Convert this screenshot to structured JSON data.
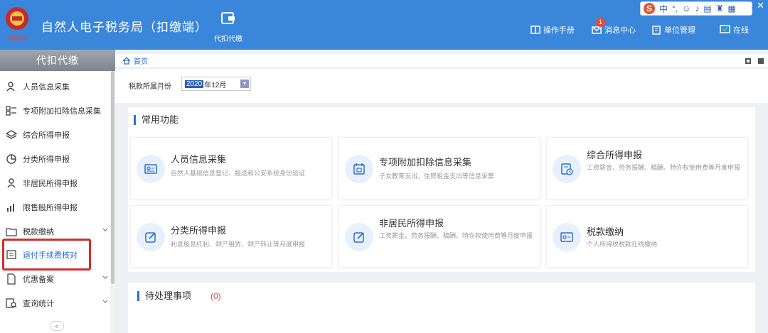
{
  "header": {
    "app_title": "自然人电子税务局（扣缴端）",
    "nav_tab": "代扣代缴",
    "manual": "操作手册",
    "messages": "消息中心",
    "message_count": "1",
    "unit_mgmt": "单位管理",
    "status": "在线",
    "ime_lang": "中"
  },
  "sidebar": {
    "title": "代扣代缴",
    "items": [
      {
        "label": "人员信息采集"
      },
      {
        "label": "专项附加扣除信息采集"
      },
      {
        "label": "综合所得申报"
      },
      {
        "label": "分类所得申报"
      },
      {
        "label": "非居民所得申报"
      },
      {
        "label": "限售股所得申报"
      },
      {
        "label": "税款缴纳"
      },
      {
        "label": "退付手续费核对"
      },
      {
        "label": "优惠备案"
      },
      {
        "label": "查询统计"
      }
    ]
  },
  "breadcrumb": {
    "home": "首页"
  },
  "filter": {
    "label": "税款所属月份",
    "year_selected": "2020",
    "month_text": "年12月"
  },
  "common": {
    "title": "常用功能",
    "cards": [
      {
        "title": "人员信息采集",
        "desc": "自然人基础信息登记、报送和公安系统身份验证"
      },
      {
        "title": "专项附加扣除信息采集",
        "desc": "子女教育支出，住房租金支出等信息采集"
      },
      {
        "title": "综合所得申报",
        "desc": "工资薪金、劳务报酬、稿酬、特许权使用费等月度申报"
      },
      {
        "title": "分类所得申报",
        "desc": "利息股息红利、财产租赁、财产转让等月度申报"
      },
      {
        "title": "非居民所得申报",
        "desc": "工资薪金、劳务报酬、稿酬、特许权使用费等月度申报"
      },
      {
        "title": "税款缴纳",
        "desc": "个人所得税税款在线缴纳"
      }
    ]
  },
  "todo": {
    "title": "待处理事项",
    "count": "(0)"
  },
  "colors": {
    "header": "#3a86db",
    "accent": "#2d6fd1",
    "highlight": "#d22d2d"
  }
}
